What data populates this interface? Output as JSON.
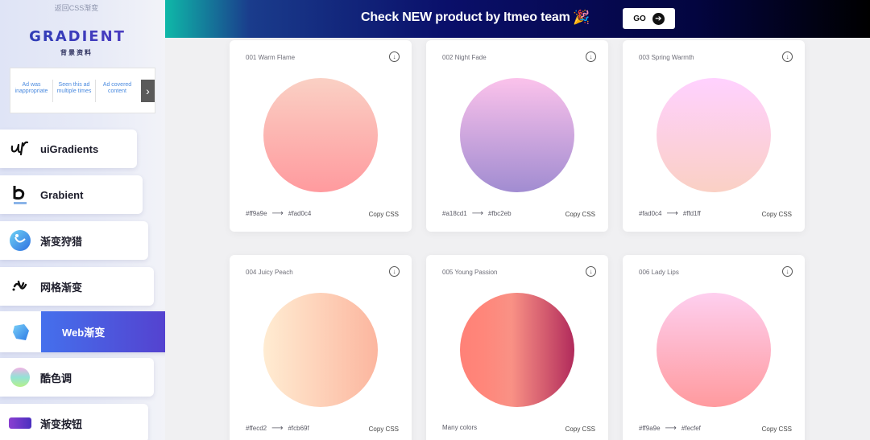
{
  "sidebar": {
    "back_link": "返回CSS渐变",
    "logo_text": "GRADIENT",
    "logo_sub": "背景资料",
    "ad": {
      "options": [
        "Ad was inappropriate",
        "Seen this ad multiple times",
        "Ad covered content"
      ],
      "arrow": "›"
    },
    "items": [
      {
        "label": "uiGradients",
        "icon": "ui-gradients-logo-icon"
      },
      {
        "label": "Grabient",
        "icon": "grabient-logo-icon"
      },
      {
        "label": "渐变狩猎",
        "icon": "gradient-hunt-logo-icon"
      },
      {
        "label": "网格渐变",
        "icon": "mesh-gradient-logo-icon"
      },
      {
        "label": "Web渐变",
        "icon": "web-gradient-logo-icon",
        "active": true
      },
      {
        "label": "酷色调",
        "icon": "cool-hues-logo-icon"
      },
      {
        "label": "渐变按钮",
        "icon": "gradient-button-logo-icon"
      }
    ]
  },
  "banner": {
    "text": "Check NEW product by Itmeo team",
    "emoji": "🎉",
    "go_label": "GO"
  },
  "cards": [
    {
      "title": "001 Warm Flame",
      "from": "#ff9a9e",
      "to": "#fad0c4",
      "colors_text_from": "#ff9a9e",
      "colors_text_to": "#fad0c4",
      "copy": "Copy CSS"
    },
    {
      "title": "002 Night Fade",
      "from": "#a18cd1",
      "to": "#fbc2eb",
      "colors_text_from": "#a18cd1",
      "colors_text_to": "#fbc2eb",
      "copy": "Copy CSS"
    },
    {
      "title": "003 Spring Warmth",
      "from": "#fad0c4",
      "to": "#ffd1ff",
      "colors_text_from": "#fad0c4",
      "colors_text_to": "#ffd1ff",
      "copy": "Copy CSS"
    },
    {
      "title": "004 Juicy Peach",
      "from": "#ffecd2",
      "to": "#fcb69f",
      "colors_text_from": "#ffecd2",
      "colors_text_to": "#fcb69f",
      "copy": "Copy CSS"
    },
    {
      "title": "005 Young Passion",
      "from": "#ff8177",
      "to": "#b12a5b",
      "many": "Many colors",
      "copy": "Copy CSS"
    },
    {
      "title": "006 Lady Lips",
      "from": "#ff9a9e",
      "to": "#fecfef",
      "colors_text_from": "#ff9a9e",
      "colors_text_to": "#fecfef",
      "copy": "Copy CSS"
    }
  ],
  "colors": {
    "active_nav_from": "#3f7ff6",
    "active_nav_to": "#5540ce",
    "banner_bg": "#030540"
  }
}
